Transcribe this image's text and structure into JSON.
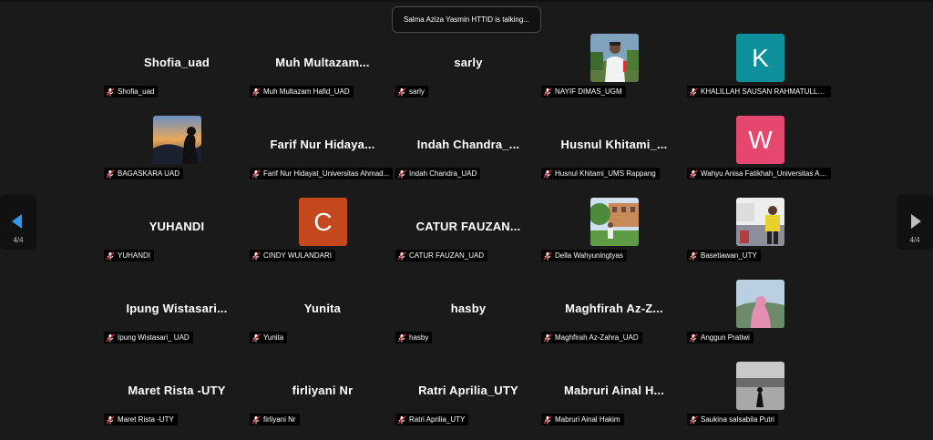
{
  "talking_banner": "Salma Aziza Yasmin HTTID is talking...",
  "nav": {
    "left_page": "4/4",
    "right_page": "4/4"
  },
  "colors": {
    "K": "#0e8f9c",
    "W": "#e5476e",
    "C": "#c5471c"
  },
  "tiles": [
    {
      "big": "Shofia_uad",
      "label": "Shofia_uad"
    },
    {
      "big": "Muh  Multazam...",
      "label": "Muh Multazam Hafid_UAD"
    },
    {
      "big": "sarly",
      "label": "sarly"
    },
    {
      "photo": "photo-outdoor-man",
      "label": "NAYIF DIMAS_UGM"
    },
    {
      "letter": "K",
      "label": "KHALILLAH SAUSAN RAHMATULLAH..."
    },
    {
      "photo": "photo-sunset-silhouette",
      "label": "BAGASKARA UAD"
    },
    {
      "big": "Farif  Nur  Hidaya...",
      "label": "Farif Nur Hidayat_Universitas Ahmad..."
    },
    {
      "big": "Indah  Chandra_...",
      "label": "Indah Chandra_UAD"
    },
    {
      "big": "Husnul  Khitami_...",
      "label": "Husnul Khitami_UMS Rappang"
    },
    {
      "letter": "W",
      "label": "Wahyu Anisa Fatikhah_Universitas Ah..."
    },
    {
      "big": "YUHANDI",
      "label": "YUHANDI"
    },
    {
      "letter": "C",
      "label": "CINDY WULANDARI"
    },
    {
      "big": "CATUR  FAUZAN...",
      "label": "CATUR FAUZAN_UAD"
    },
    {
      "photo": "photo-garden-person",
      "label": "Della Wahyuningtyas"
    },
    {
      "photo": "photo-yellow-jersey",
      "label": "Basetiawan_UTY"
    },
    {
      "big": "Ipung  Wistasari...",
      "label": "Ipung Wistasari_ UAD"
    },
    {
      "big": "Yunita",
      "label": "Yunita"
    },
    {
      "big": "hasby",
      "label": "hasby"
    },
    {
      "big": "Maghfirah  Az-Z...",
      "label": "Maghfirah Az-Zahra_UAD"
    },
    {
      "photo": "photo-pink-hijab",
      "label": "Anggun Pratiwi"
    },
    {
      "big": "Maret Rista -UTY",
      "label": "Maret Rista -UTY"
    },
    {
      "big": "firliyani Nr",
      "label": "firliyani Nr"
    },
    {
      "big": "Ratri Aprilia_UTY",
      "label": "Ratri Aprilia_UTY"
    },
    {
      "big": "Mabruri  Ainal  H...",
      "label": "Mabruri Ainal Hakim"
    },
    {
      "photo": "photo-beach-bw",
      "label": "Saukina salsabila Putri"
    }
  ]
}
